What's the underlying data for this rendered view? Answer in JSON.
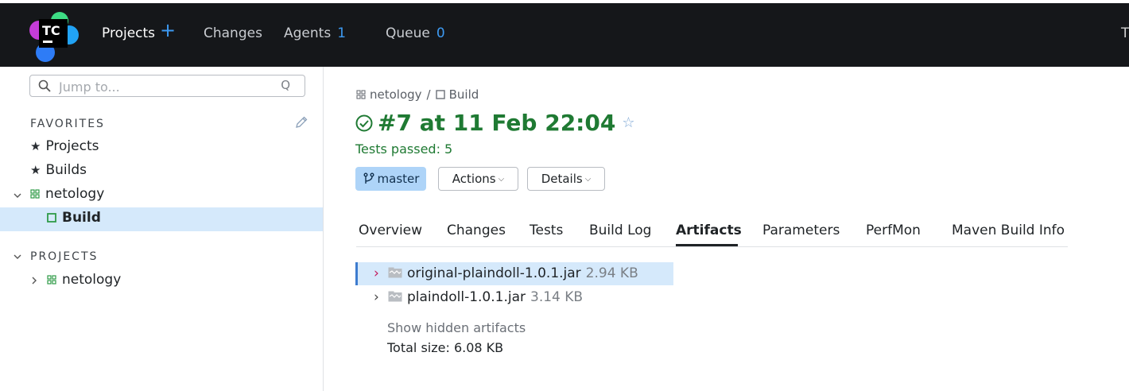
{
  "header": {
    "logo_text": "TC",
    "nav": {
      "projects": "Projects",
      "changes": "Changes",
      "agents": "Agents",
      "agents_count": "1",
      "queue": "Queue",
      "queue_count": "0"
    },
    "user_initial": "T"
  },
  "sidebar": {
    "search_placeholder": "Jump to...",
    "search_hint": "Q",
    "favorites_title": "FAVORITES",
    "favorites": [
      "Projects",
      "Builds"
    ],
    "fav_project": "netology",
    "fav_build": "Build",
    "projects_title": "PROJECTS",
    "project": "netology"
  },
  "main": {
    "breadcrumb": {
      "project": "netology",
      "sep": "/",
      "build": "Build"
    },
    "title": "#7 at 11 Feb 22:04",
    "tests_status": "Tests passed: 5",
    "branch": "master",
    "actions_label": "Actions",
    "details_label": "Details",
    "tabs": [
      "Overview",
      "Changes",
      "Tests",
      "Build Log",
      "Artifacts",
      "Parameters",
      "PerfMon",
      "Maven Build Info"
    ],
    "active_tab": "Artifacts",
    "artifacts": [
      {
        "name": "original-plaindoll-1.0.1.jar",
        "size": "2.94 KB"
      },
      {
        "name": "plaindoll-1.0.1.jar",
        "size": "3.14 KB"
      }
    ],
    "show_hidden": "Show hidden artifacts",
    "total_size": "Total size: 6.08 KB"
  },
  "colors": {
    "header_bg": "#15171a",
    "success": "#1f7a33",
    "accent": "#3d9af2",
    "selection": "#d5e9fb",
    "branch_bg": "#aed4f8"
  }
}
